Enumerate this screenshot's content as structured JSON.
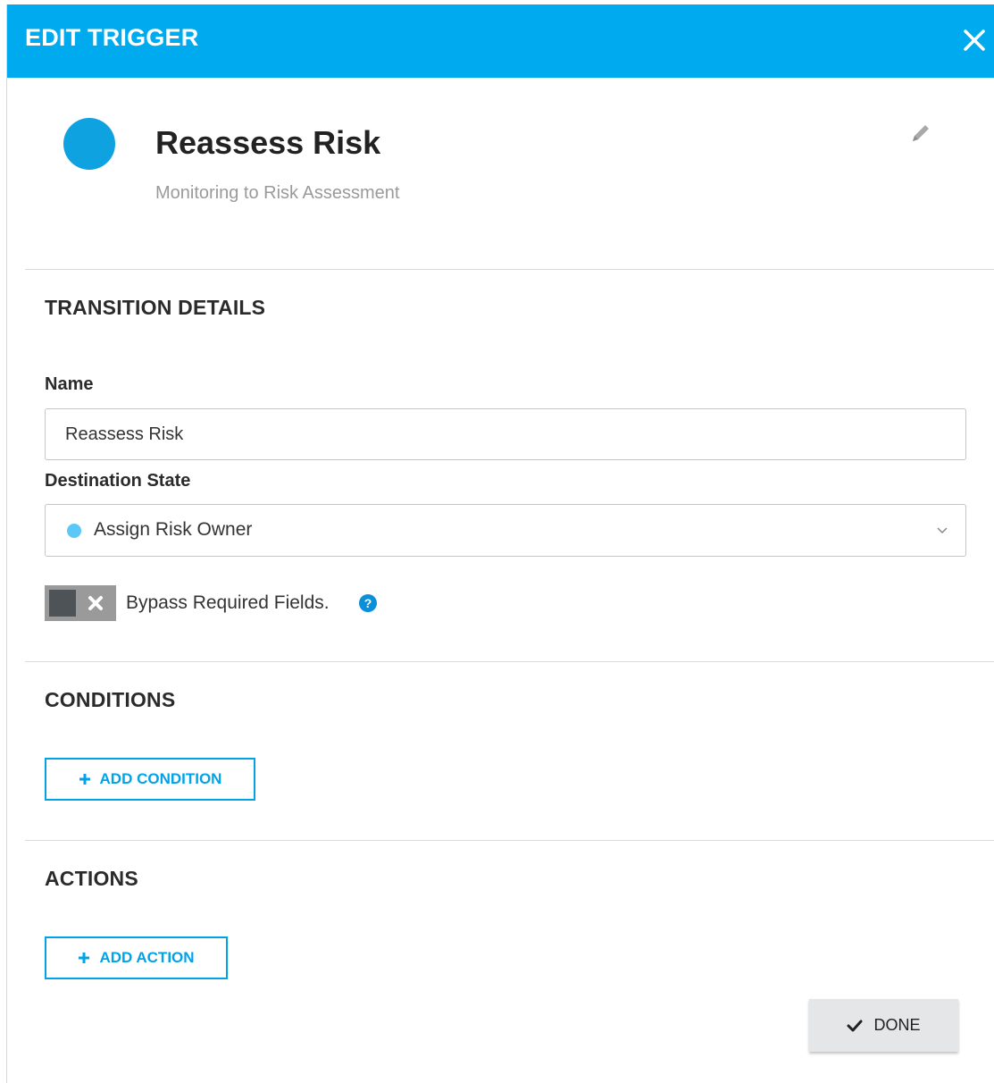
{
  "header": {
    "title": "EDIT TRIGGER",
    "close_icon": "close-icon"
  },
  "summary": {
    "title": "Reassess Risk",
    "subtitle": "Monitoring to Risk Assessment",
    "dot_color": "#0ea2e0",
    "edit_icon": "pencil-icon"
  },
  "transition_details": {
    "heading": "TRANSITION DETAILS",
    "name_label": "Name",
    "name_value": "Reassess Risk",
    "destination_label": "Destination State",
    "destination_value": "Assign Risk Owner",
    "destination_dot_color": "#5bc8f5",
    "bypass_label": "Bypass Required Fields.",
    "bypass_enabled": false
  },
  "conditions": {
    "heading": "CONDITIONS",
    "add_button": "ADD CONDITION"
  },
  "actions": {
    "heading": "ACTIONS",
    "add_button": "ADD ACTION"
  },
  "footer": {
    "done_button": "DONE"
  },
  "colors": {
    "accent": "#00aaee",
    "button_outline": "#00a2e8"
  }
}
